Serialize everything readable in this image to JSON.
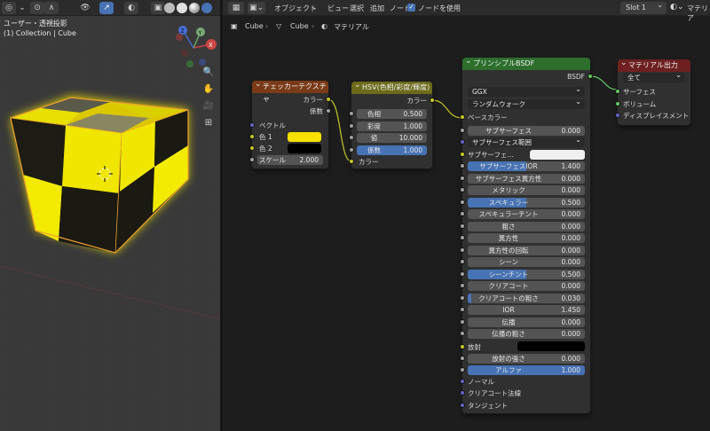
{
  "viewport": {
    "title": "ユーザー・透視投影",
    "collection": "(1) Collection | Cube",
    "gizmo": {
      "x": "X",
      "y": "Y",
      "z": "Z"
    }
  },
  "header": {
    "menus": [
      "オブジェクト",
      "ビュー",
      "選択",
      "追加",
      "ノード"
    ],
    "use_nodes_label": "ノードを使用",
    "slot": "Slot 1",
    "material_label": "マテリア"
  },
  "breadcrumb": {
    "object": "Cube",
    "mesh": "Cube",
    "material": "マテリアル"
  },
  "checker": {
    "title": "チェッカーテクスチャ",
    "out_color": "カラー",
    "out_fac": "係数",
    "vector": "ベクトル",
    "color1": "色 1",
    "color2": "色 2",
    "scale_label": "スケール",
    "scale_value": "2.000",
    "color1_hex": "#f5e000",
    "color2_hex": "#000000"
  },
  "hsv": {
    "title": "HSV(色相/彩度/輝度)",
    "out_color": "カラー",
    "hue_label": "色相",
    "hue": "0.500",
    "sat_label": "彩度",
    "sat": "1.000",
    "val_label": "値",
    "val": "10.000",
    "fac_label": "係数",
    "fac": "1.000",
    "in_color": "カラー"
  },
  "bsdf": {
    "title": "プリンシプルBSDF",
    "out": "BSDF",
    "distribution": "GGX",
    "subsurface_method": "ランダムウォーク",
    "base_color": "ベースカラー",
    "subsurface": {
      "label": "サブサーフェス",
      "value": "0.000"
    },
    "subsurface_radius": "サブサーフェス範囲",
    "subsurface_color": "サブサーフェ...",
    "params": [
      {
        "label": "サブサーフェスIOR",
        "value": "1.400",
        "fill": 0.5
      },
      {
        "label": "サブサーフェス異方性",
        "value": "0.000",
        "fill": 0
      },
      {
        "label": "メタリック",
        "value": "0.000",
        "fill": 0
      },
      {
        "label": "スペキュラー",
        "value": "0.500",
        "fill": 0.5
      },
      {
        "label": "スペキュラーチント",
        "value": "0.000",
        "fill": 0
      },
      {
        "label": "粗さ",
        "value": "0.000",
        "fill": 0
      },
      {
        "label": "異方性",
        "value": "0.000",
        "fill": 0
      },
      {
        "label": "異方性の回転",
        "value": "0.000",
        "fill": 0
      },
      {
        "label": "シーン",
        "value": "0.000",
        "fill": 0
      },
      {
        "label": "シーンチント",
        "value": "0.500",
        "fill": 0.5
      },
      {
        "label": "クリアコート",
        "value": "0.000",
        "fill": 0
      },
      {
        "label": "クリアコートの粗さ",
        "value": "0.030",
        "fill": 0.03
      },
      {
        "label": "IOR",
        "value": "1.450",
        "fill": 0
      },
      {
        "label": "伝播",
        "value": "0.000",
        "fill": 0
      },
      {
        "label": "伝播の粗さ",
        "value": "0.000",
        "fill": 0
      }
    ],
    "emission": "放射",
    "emission_strength": {
      "label": "放射の強さ",
      "value": "0.000"
    },
    "alpha": {
      "label": "アルファ",
      "value": "1.000"
    },
    "normal": "ノーマル",
    "clearcoat_normal": "クリアコート法線",
    "tangent": "タンジェント"
  },
  "output": {
    "title": "マテリアル出力",
    "target": "全て",
    "surface": "サーフェス",
    "volume": "ボリューム",
    "displacement": "ディスプレイスメント"
  },
  "colors": {
    "texture_header": "#7a3a17",
    "color_header": "#6b6b1b",
    "shader_header": "#2d6e2d",
    "output_header": "#6e2020",
    "accent": "#4772b3"
  }
}
